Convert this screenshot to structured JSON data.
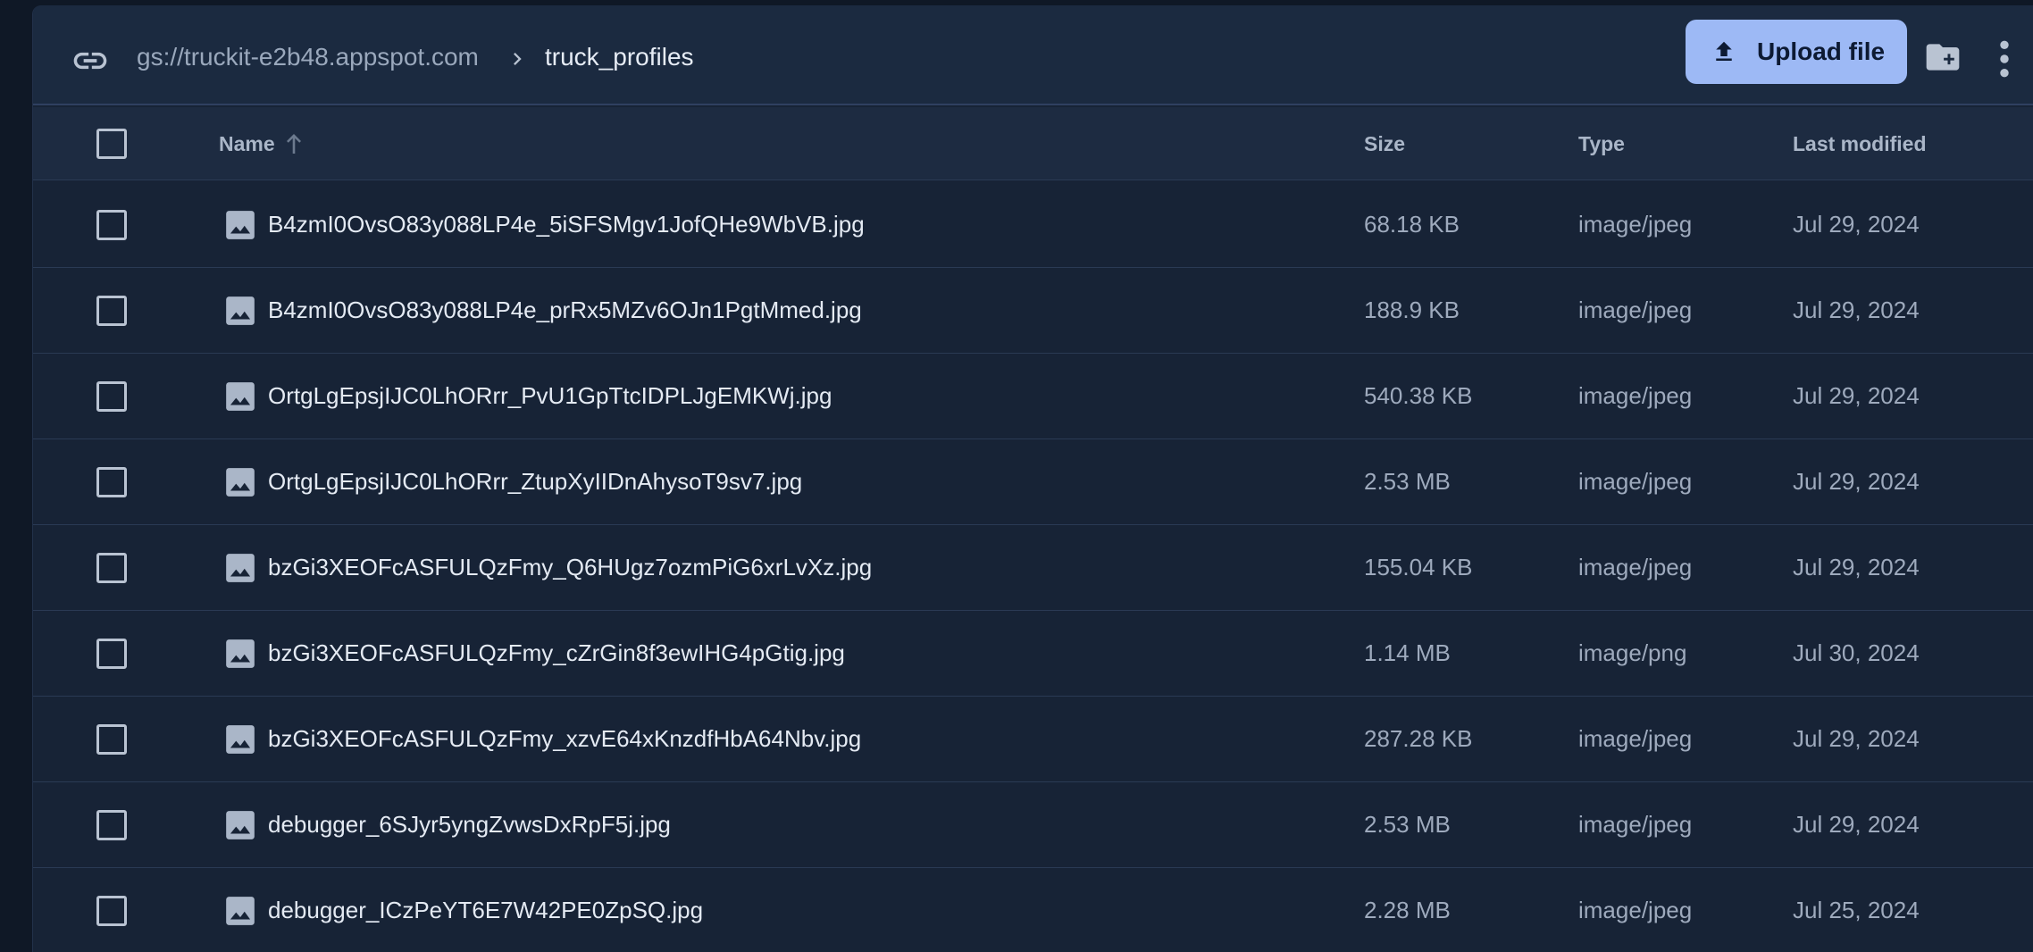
{
  "colors": {
    "background": "#0f1826",
    "panel": "#172336",
    "toolbar": "#1b2a40",
    "accent_button": "#9db9f5",
    "text_primary": "#e4eaf3",
    "text_secondary": "#9eaabd"
  },
  "toolbar": {
    "link_icon": "link-icon",
    "bucket": "gs://truckit-e2b48.appspot.com",
    "separator_icon": "chevron-right-icon",
    "folder": "truck_profiles",
    "upload_label": "Upload file",
    "upload_icon": "upload-icon",
    "new_folder_icon": "create-folder-icon",
    "more_icon": "more-vertical-icon"
  },
  "table": {
    "headers": {
      "name": "Name",
      "size": "Size",
      "type": "Type",
      "modified": "Last modified"
    },
    "sort_icon": "arrow-up-icon",
    "row_icon": "image-icon",
    "rows": [
      {
        "name": "B4zmI0OvsO83y088LP4e_5iSFSMgv1JofQHe9WbVB.jpg",
        "size": "68.18 KB",
        "type": "image/jpeg",
        "modified": "Jul 29, 2024"
      },
      {
        "name": "B4zmI0OvsO83y088LP4e_prRx5MZv6OJn1PgtMmed.jpg",
        "size": "188.9 KB",
        "type": "image/jpeg",
        "modified": "Jul 29, 2024"
      },
      {
        "name": "OrtgLgEpsjIJC0LhORrr_PvU1GpTtcIDPLJgEMKWj.jpg",
        "size": "540.38 KB",
        "type": "image/jpeg",
        "modified": "Jul 29, 2024"
      },
      {
        "name": "OrtgLgEpsjIJC0LhORrr_ZtupXyIIDnAhysoT9sv7.jpg",
        "size": "2.53 MB",
        "type": "image/jpeg",
        "modified": "Jul 29, 2024"
      },
      {
        "name": "bzGi3XEOFcASFULQzFmy_Q6HUgz7ozmPiG6xrLvXz.jpg",
        "size": "155.04 KB",
        "type": "image/jpeg",
        "modified": "Jul 29, 2024"
      },
      {
        "name": "bzGi3XEOFcASFULQzFmy_cZrGin8f3ewIHG4pGtig.jpg",
        "size": "1.14 MB",
        "type": "image/png",
        "modified": "Jul 30, 2024"
      },
      {
        "name": "bzGi3XEOFcASFULQzFmy_xzvE64xKnzdfHbA64Nbv.jpg",
        "size": "287.28 KB",
        "type": "image/jpeg",
        "modified": "Jul 29, 2024"
      },
      {
        "name": "debugger_6SJyr5yngZvwsDxRpF5j.jpg",
        "size": "2.53 MB",
        "type": "image/jpeg",
        "modified": "Jul 29, 2024"
      },
      {
        "name": "debugger_ICzPeYT6E7W42PE0ZpSQ.jpg",
        "size": "2.28 MB",
        "type": "image/jpeg",
        "modified": "Jul 25, 2024"
      }
    ]
  }
}
